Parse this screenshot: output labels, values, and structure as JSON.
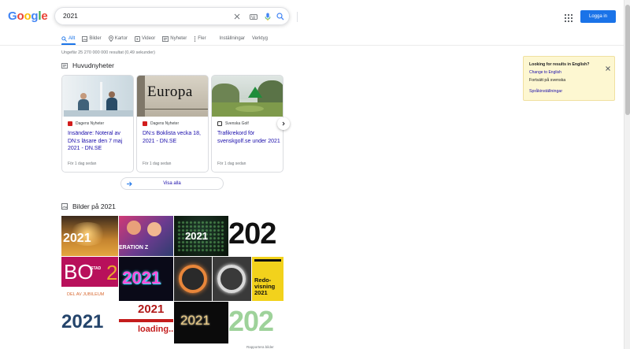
{
  "logo": {
    "letters": [
      "G",
      "o",
      "o",
      "g",
      "l",
      "e"
    ],
    "colors": [
      "#4285f4",
      "#ea4335",
      "#fbbc05",
      "#4285f4",
      "#34a853",
      "#ea4335"
    ]
  },
  "search": {
    "query": "2021"
  },
  "header": {
    "login_label": "Logga in"
  },
  "tabs": [
    {
      "label": "Allt",
      "icon": "search-icon",
      "active": true
    },
    {
      "label": "Bilder",
      "icon": "image-icon"
    },
    {
      "label": "Kartor",
      "icon": "map-pin-icon"
    },
    {
      "label": "Videor",
      "icon": "video-icon"
    },
    {
      "label": "Nyheter",
      "icon": "news-icon"
    },
    {
      "label": "Fler",
      "icon": "more-icon"
    },
    {
      "label": "Inställningar"
    },
    {
      "label": "Verktyg"
    }
  ],
  "result_stats": "Ungefär 25 270 000 000 resultat (0,49 sekunder)",
  "news": {
    "title": "Huvudnyheter",
    "cards": [
      {
        "source": "Dagens Nyheter",
        "title": "Insändare: Noteral av DN:s läsare den 7 maj 2021 - DN.SE",
        "time": "För 1 dag sedan"
      },
      {
        "source": "Dagens Nyheter",
        "title": "DN:s Boklista vecka 18, 2021 - DN.SE",
        "time": "För 1 dag sedan",
        "image_text": "Europa"
      },
      {
        "source": "Svenska Golf",
        "title": "Trafikrekord för svenskgolf.se under 2021",
        "time": "För 1 dag sedan"
      }
    ],
    "view_all": "Visa alla"
  },
  "images": {
    "title": "Bilder på 2021",
    "tile_texts": {
      "t1": "2021",
      "t2": "ERATION Z",
      "t3": "2021",
      "t4": "202",
      "t5a": "BO",
      "t5b": "STAD",
      "t5c": "DEL AV JUBILEUM",
      "t6": "2021",
      "t9a": "Redo-",
      "t9b": "visning",
      "t9c": "2021",
      "t10": "2021",
      "t11a": "2021",
      "t11b": "loading..",
      "t12": "2021",
      "t13": "202"
    },
    "caption": "Rapportera bilder"
  },
  "language_box": {
    "title": "Looking for results in English?",
    "link1": "Change to English",
    "link2": "Fortsätt på svenska",
    "link3": "Språkinställningar"
  },
  "colors": {
    "accent": "#1a73e8",
    "link": "#1a0dab"
  }
}
